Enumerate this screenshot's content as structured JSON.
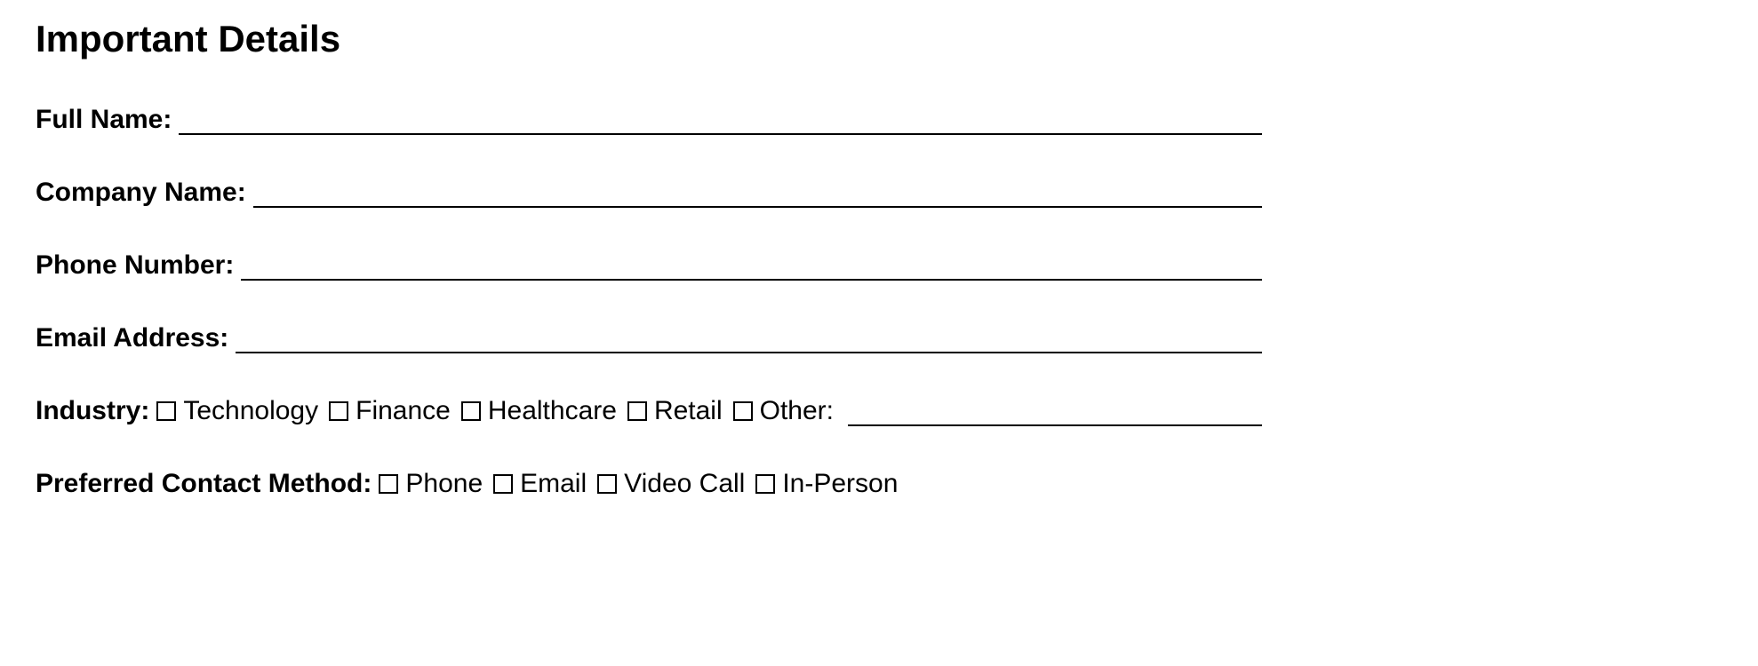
{
  "title": "Important Details",
  "fields": {
    "fullName": {
      "label": "Full Name:"
    },
    "companyName": {
      "label": "Company Name:"
    },
    "phoneNumber": {
      "label": "Phone Number:"
    },
    "emailAddress": {
      "label": "Email Address:"
    }
  },
  "industry": {
    "label": "Industry:",
    "options": {
      "technology": "Technology",
      "finance": "Finance",
      "healthcare": "Healthcare",
      "retail": "Retail",
      "other": "Other:"
    }
  },
  "contactMethod": {
    "label": "Preferred Contact Method:",
    "options": {
      "phone": "Phone",
      "email": "Email",
      "videoCall": "Video Call",
      "inPerson": "In-Person"
    }
  }
}
